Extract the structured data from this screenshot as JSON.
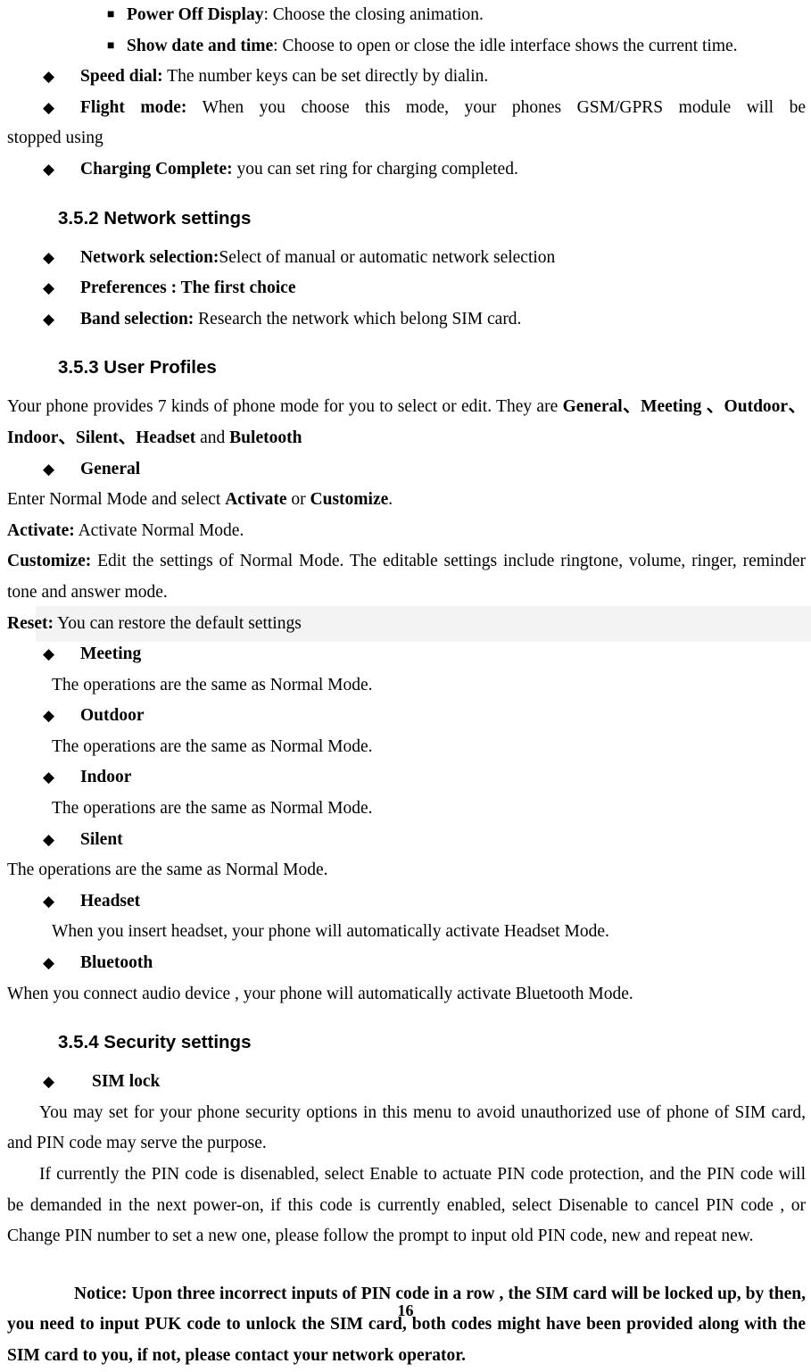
{
  "document": {
    "page_number": "16",
    "bullet_glyphs": {
      "diamond": "◆",
      "square": "■"
    }
  },
  "display_options": [
    {
      "bullet": "■",
      "term": "Power Off Display",
      "separator": ": ",
      "text": "Choose the closing animation."
    },
    {
      "bullet": "■",
      "term": "Show date and time",
      "separator": ": ",
      "text": "Choose to open or close the idle interface shows the current time."
    }
  ],
  "settings_items": [
    {
      "bullet": "◆",
      "term": "Speed dial:",
      "text": " The number keys can be set directly by dialin."
    },
    {
      "bullet": "◆",
      "term": "Flight mode:",
      "text": " When you choose this mode,  your phones GSM/GPRS module will be",
      "continuation": "stopped using"
    },
    {
      "bullet": "◆",
      "term": "Charging Complete:",
      "text": " you can set ring for charging completed."
    }
  ],
  "network_settings": {
    "heading": "3.5.2 Network settings",
    "items": [
      {
        "bullet": "◆",
        "term": "Network selection:",
        "text": "Select of manual or automatic network selection",
        "term_bold_only": true
      },
      {
        "bullet": "◆",
        "term": "Preferences : The first choice",
        "text": "",
        "all_bold": true
      },
      {
        "bullet": "◆",
        "term": "Band selection:",
        "text": " Research the network which belong SIM card."
      }
    ]
  },
  "user_profiles": {
    "heading": "3.5.3 User Profiles",
    "intro": {
      "lead": "Your phone provides 7 kinds of phone mode for you to select or edit. They are ",
      "modes_bold": "General、Meeting 、Outdoor、Indoor、Silent、Headset",
      "mode_1": "General、",
      "mode_2": "Meeting 、Outdoor、Indoor、Silent、Headset",
      "conjunction": " and ",
      "mode_last": "Buletooth"
    },
    "general": {
      "bullet": "◆",
      "label": "General",
      "line1_a": "Enter Normal Mode and select ",
      "line1_b": "Activate",
      "line1_c": " or ",
      "line1_d": "Customize",
      "line1_e": ".",
      "activate_term": "Activate:",
      "activate_text": " Activate Normal Mode.",
      "customize_term": "Customize:",
      "customize_text": " Edit the settings of Normal Mode. The editable settings include ringtone, volume, ringer, reminder tone and answer mode.",
      "reset_term": "Reset:",
      "reset_text": " You can restore the default settings",
      "reset_highlight_color": "#f3f3f3"
    },
    "modes": [
      {
        "bullet": "◆",
        "label": "Meeting",
        "description": "The operations are the same as Normal Mode.",
        "indented": true
      },
      {
        "bullet": "◆",
        "label": "Outdoor",
        "description": "The operations are the same as Normal Mode.",
        "indented": true
      },
      {
        "bullet": "◆",
        "label": "Indoor",
        "description": "The operations are the same as Normal Mode.",
        "indented": true
      },
      {
        "bullet": "◆",
        "label": "Silent",
        "description": "The operations are the same as Normal Mode.",
        "indented": false
      },
      {
        "bullet": "◆",
        "label": "Headset",
        "description": "When you insert headset, your phone will automatically activate Headset Mode.",
        "indented": true
      },
      {
        "bullet": "◆",
        "label": "Bluetooth",
        "description": "When you connect audio device , your phone will automatically activate Bluetooth Mode.",
        "indented": false
      }
    ]
  },
  "security_settings": {
    "heading": "3.5.4 Security settings",
    "sim_lock": {
      "bullet": "◆",
      "label": "SIM lock",
      "paragraph_1": "You may set for your phone security options in this menu to avoid unauthorized use of phone of SIM card, and PIN code may serve the purpose.",
      "paragraph_2": "If currently the PIN code is disenabled, select Enable to actuate PIN code protection, and the PIN code will be demanded in the next power-on, if this code is currently enabled, select Disenable to cancel PIN code , or Change PIN number to set a new one, please follow the prompt to input old PIN code, new and repeat new.",
      "notice": "Notice: Upon three incorrect inputs of PIN code in a row , the SIM card will be locked up, by then, you need to input PUK code to unlock the SIM card, both codes might have been provided along with the SIM card to you, if not, please contact your network operator."
    }
  }
}
